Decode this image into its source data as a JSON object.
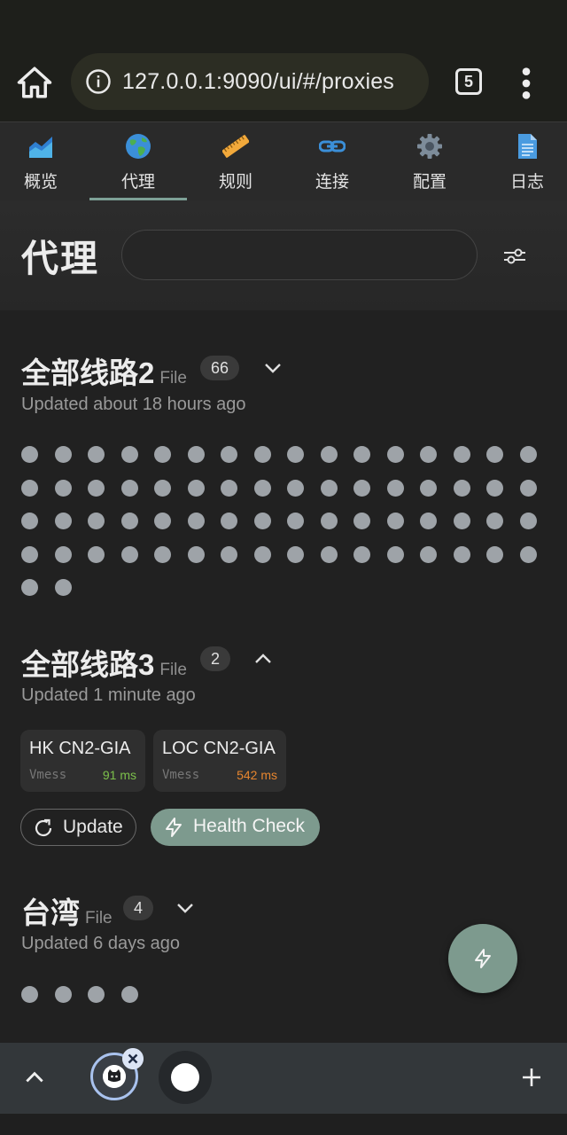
{
  "browser": {
    "url": "127.0.0.1:9090/ui/#/proxies",
    "tab_count": "5"
  },
  "nav": {
    "items": [
      {
        "label": "概览",
        "icon": "chart-icon"
      },
      {
        "label": "代理",
        "icon": "globe-icon",
        "active": true
      },
      {
        "label": "规则",
        "icon": "ruler-icon"
      },
      {
        "label": "连接",
        "icon": "link-icon"
      },
      {
        "label": "配置",
        "icon": "gear-icon"
      },
      {
        "label": "日志",
        "icon": "document-icon"
      }
    ]
  },
  "header": {
    "title": "代理",
    "search_placeholder": ""
  },
  "groups": [
    {
      "name": "全部线路2",
      "type": "File",
      "count": "66",
      "updated": "Updated about 18 hours ago",
      "expanded": false
    },
    {
      "name": "全部线路3",
      "type": "File",
      "count": "2",
      "updated": "Updated 1 minute ago",
      "expanded": true,
      "proxies": [
        {
          "name": "HK CN2-GIA",
          "type": "Vmess",
          "latency": "91 ms",
          "latency_color": "#7cc04b"
        },
        {
          "name": "LOC CN2-GIA",
          "type": "Vmess",
          "latency": "542 ms",
          "latency_color": "#e7862f"
        }
      ],
      "update_label": "Update",
      "health_label": "Health Check"
    },
    {
      "name": "台湾",
      "type": "File",
      "count": "4",
      "updated": "Updated 6 days ago",
      "expanded": false
    }
  ],
  "colors": {
    "accent": "#7d9a8e",
    "background": "#212121",
    "dot": "#9ea3a8"
  }
}
